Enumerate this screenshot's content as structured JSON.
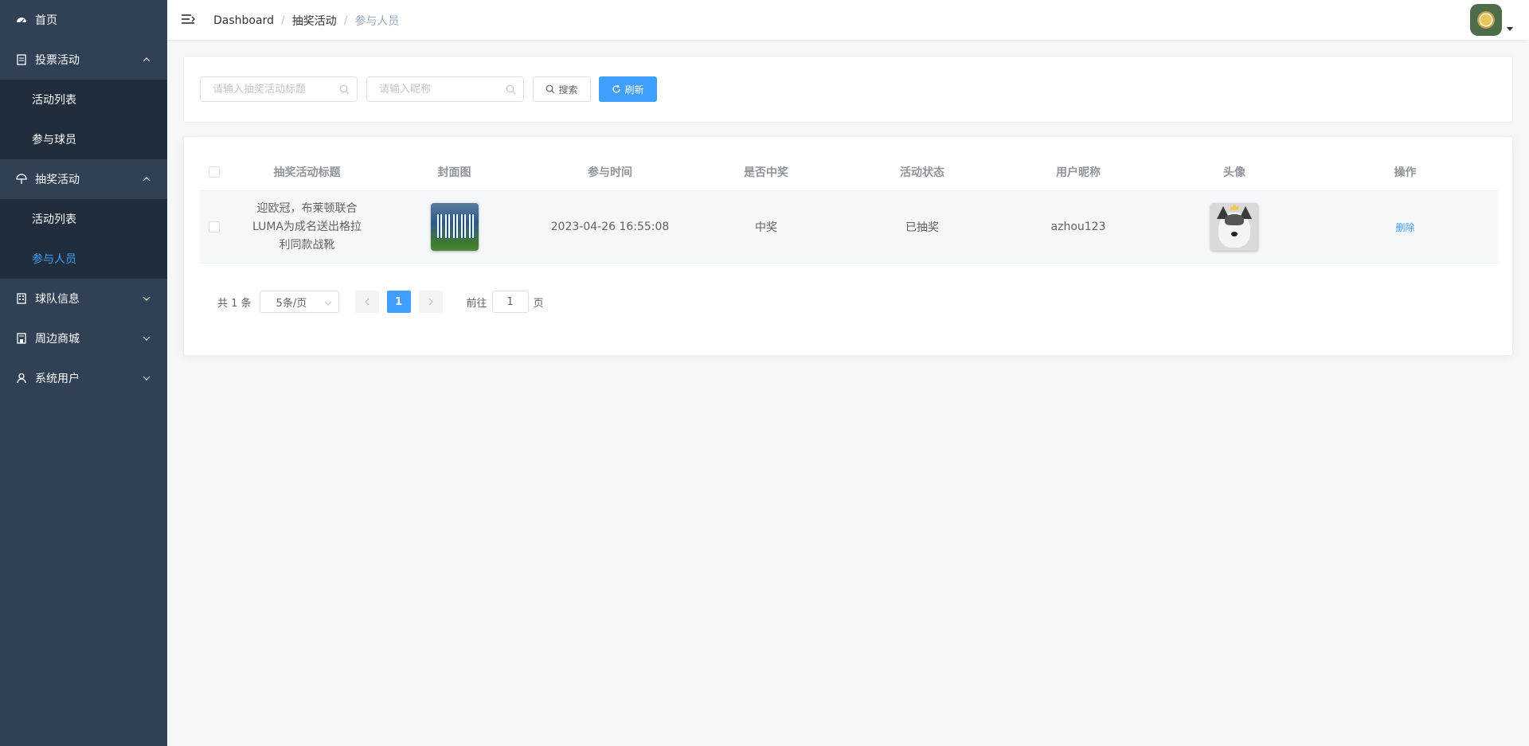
{
  "sidebar": {
    "home": "首页",
    "vote": {
      "label": "投票活动",
      "items": [
        "活动列表",
        "参与球员"
      ]
    },
    "lottery": {
      "label": "抽奖活动",
      "items": [
        "活动列表",
        "参与人员"
      ]
    },
    "team": "球队信息",
    "shop": "周边商城",
    "users": "系统用户"
  },
  "breadcrumb": [
    "Dashboard",
    "抽奖活动",
    "参与人员"
  ],
  "breadcrumb_sep": "/",
  "search": {
    "title_placeholder": "请输入抽奖活动标题",
    "nickname_placeholder": "请输入昵称",
    "search_label": "搜索",
    "refresh_label": "刷新"
  },
  "table": {
    "headers": [
      "抽奖活动标题",
      "封面图",
      "参与时间",
      "是否中奖",
      "活动状态",
      "用户昵称",
      "头像",
      "操作"
    ],
    "rows": [
      {
        "title": "迎欧冠，布莱顿联合LUMA为成名送出格拉利同款战靴",
        "participate_time": "2023-04-26 16:55:08",
        "is_winner": "中奖",
        "status": "已抽奖",
        "nickname": "azhou123",
        "action": "删除"
      }
    ]
  },
  "pagination": {
    "total": "共 1 条",
    "page_size": "5条/页",
    "current_page": "1",
    "goto_prefix": "前往",
    "goto_value": "1",
    "goto_suffix": "页"
  },
  "colors": {
    "sidebar_bg": "#304156",
    "submenu_bg": "#1f2d3d",
    "accent": "#409eff"
  }
}
